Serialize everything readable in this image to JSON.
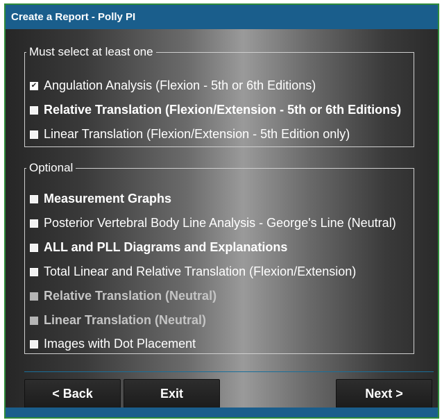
{
  "window": {
    "title": "Create a Report - Polly PI"
  },
  "required_group": {
    "legend": "Must select at least one",
    "options": [
      {
        "label": "Angulation Analysis (Flexion - 5th or 6th Editions)",
        "checked": true
      },
      {
        "label": "Relative Translation (Flexion/Extension - 5th or 6th Editions)",
        "checked": false
      },
      {
        "label": "Linear Translation (Flexion/Extension - 5th Edition only)",
        "checked": false
      }
    ]
  },
  "optional_group": {
    "legend": "Optional",
    "options": [
      {
        "label": "Measurement Graphs",
        "checked": false,
        "enabled": true
      },
      {
        "label": "Posterior Vertebral Body Line Analysis - George's Line (Neutral)",
        "checked": false,
        "enabled": true
      },
      {
        "label": "ALL and PLL Diagrams and Explanations",
        "checked": false,
        "enabled": true
      },
      {
        "label": "Total Linear and Relative Translation (Flexion/Extension)",
        "checked": false,
        "enabled": true
      },
      {
        "label": "Relative Translation (Neutral)",
        "checked": false,
        "enabled": false
      },
      {
        "label": "Linear Translation (Neutral)",
        "checked": false,
        "enabled": false
      },
      {
        "label": "Images with Dot Placement",
        "checked": false,
        "enabled": true
      }
    ]
  },
  "buttons": {
    "back": "< Back",
    "exit": "Exit",
    "next": "Next >"
  },
  "check_mark": "☑",
  "colors": {
    "titlebar": "#1a5e8c",
    "window_border": "#2e8b3a",
    "separator": "#1a6f9a"
  }
}
